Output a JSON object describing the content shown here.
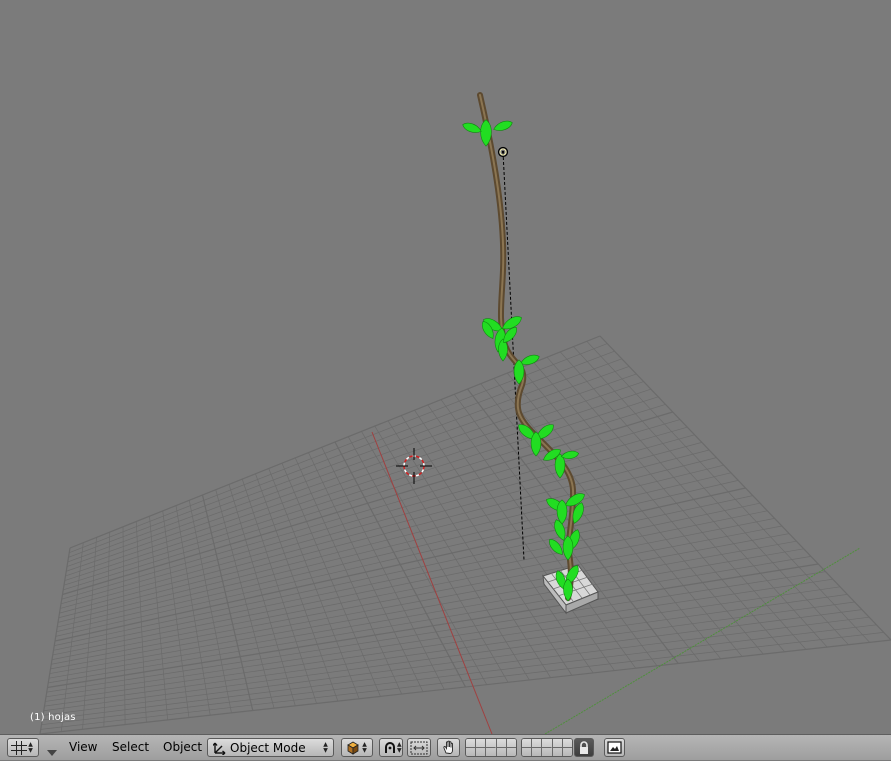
{
  "viewport": {
    "object_info": "(1) hojas"
  },
  "header": {
    "editor_type_icon": "grid-icon",
    "collapse_icon": "triangle-down-icon",
    "menus": {
      "view": "View",
      "select": "Select",
      "object": "Object"
    },
    "mode_select": {
      "label": "Object Mode",
      "icon": "object-mode-icon"
    },
    "draw_type_icon": "solid-cube-icon",
    "pivot_icon": "pivot-icon",
    "transform_icon": "transform-manipulator-icon",
    "hand_icon": "hand-icon",
    "layer_lock_icon": "lock-icon",
    "render_icon": "render-image-icon"
  },
  "colors": {
    "background": "#7b7b7b",
    "grid": "#6b6b6b",
    "x_axis": "#a04040",
    "y_axis": "#5a9a40",
    "leaf": "#22dd22",
    "stem": "#6b5335",
    "header": "#a8a8a8"
  }
}
